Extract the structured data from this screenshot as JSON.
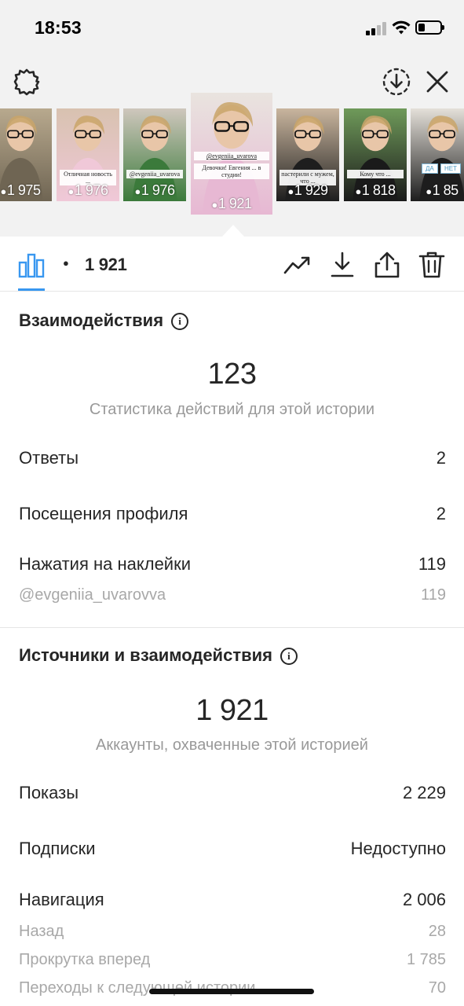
{
  "status_bar": {
    "time": "18:53",
    "battery_level": 0.3
  },
  "top_bar": {
    "settings_icon": "settings-gear-icon",
    "download_icon": "download-circle-icon",
    "close_icon": "close-icon"
  },
  "stories": [
    {
      "views": "1 975",
      "colors": [
        "#b8a98e",
        "#6f6553"
      ]
    },
    {
      "views": "1 976",
      "colors": [
        "#d8c2b0",
        "#f0c8d8"
      ],
      "caption": "Отличная новость ..."
    },
    {
      "views": "1 976",
      "colors": [
        "#cfc7bd",
        "#3b7a3b"
      ],
      "caption": "@evgeniia_uvarova"
    },
    {
      "views": "1 921",
      "colors": [
        "#e9e4df",
        "#e7b8d3"
      ],
      "caption_top": "@evgeniia_uvarova",
      "caption": "Девочки! Евгения ... в студии!",
      "active": true
    },
    {
      "views": "1 929",
      "colors": [
        "#c9b59e",
        "#1e1e1e"
      ],
      "caption": "пастерили с мужем, что ..."
    },
    {
      "views": "1 818",
      "colors": [
        "#6f9a5a",
        "#1a1a1a"
      ],
      "caption": "Кому что ..."
    },
    {
      "views": "1 85",
      "colors": [
        "#e4e0d9",
        "#1d1d1d"
      ],
      "badge_yes": "ДА",
      "badge_no": "НЕТ"
    }
  ],
  "toolbar": {
    "views": "1 921",
    "eye_icon": "eye-icon",
    "chart_icon": "bar-chart-icon",
    "trend_icon": "trending-up-icon",
    "download_icon": "download-icon",
    "share_icon": "share-icon",
    "delete_icon": "trash-icon"
  },
  "interactions": {
    "title": "Взаимодействия",
    "total": "123",
    "subtitle": "Статистика действий для этой истории",
    "rows": [
      {
        "label": "Ответы",
        "value": "2"
      },
      {
        "label": "Посещения профиля",
        "value": "2"
      },
      {
        "label": "Нажатия на наклейки",
        "value": "119"
      }
    ],
    "sticker_sub": {
      "label": "@evgeniia_uvarovva",
      "value": "119"
    }
  },
  "sources": {
    "title": "Источники и взаимодействия",
    "total": "1 921",
    "subtitle": "Аккаунты, охваченные этой историей",
    "rows": [
      {
        "label": "Показы",
        "value": "2 229"
      },
      {
        "label": "Подписки",
        "value": "Недоступно"
      },
      {
        "label": "Навигация",
        "value": "2 006"
      }
    ],
    "nav_sub": [
      {
        "label": "Назад",
        "value": "28"
      },
      {
        "label": "Прокрутка вперед",
        "value": "1 785"
      },
      {
        "label": "Переходы к следующей истории",
        "value": "70"
      }
    ]
  }
}
